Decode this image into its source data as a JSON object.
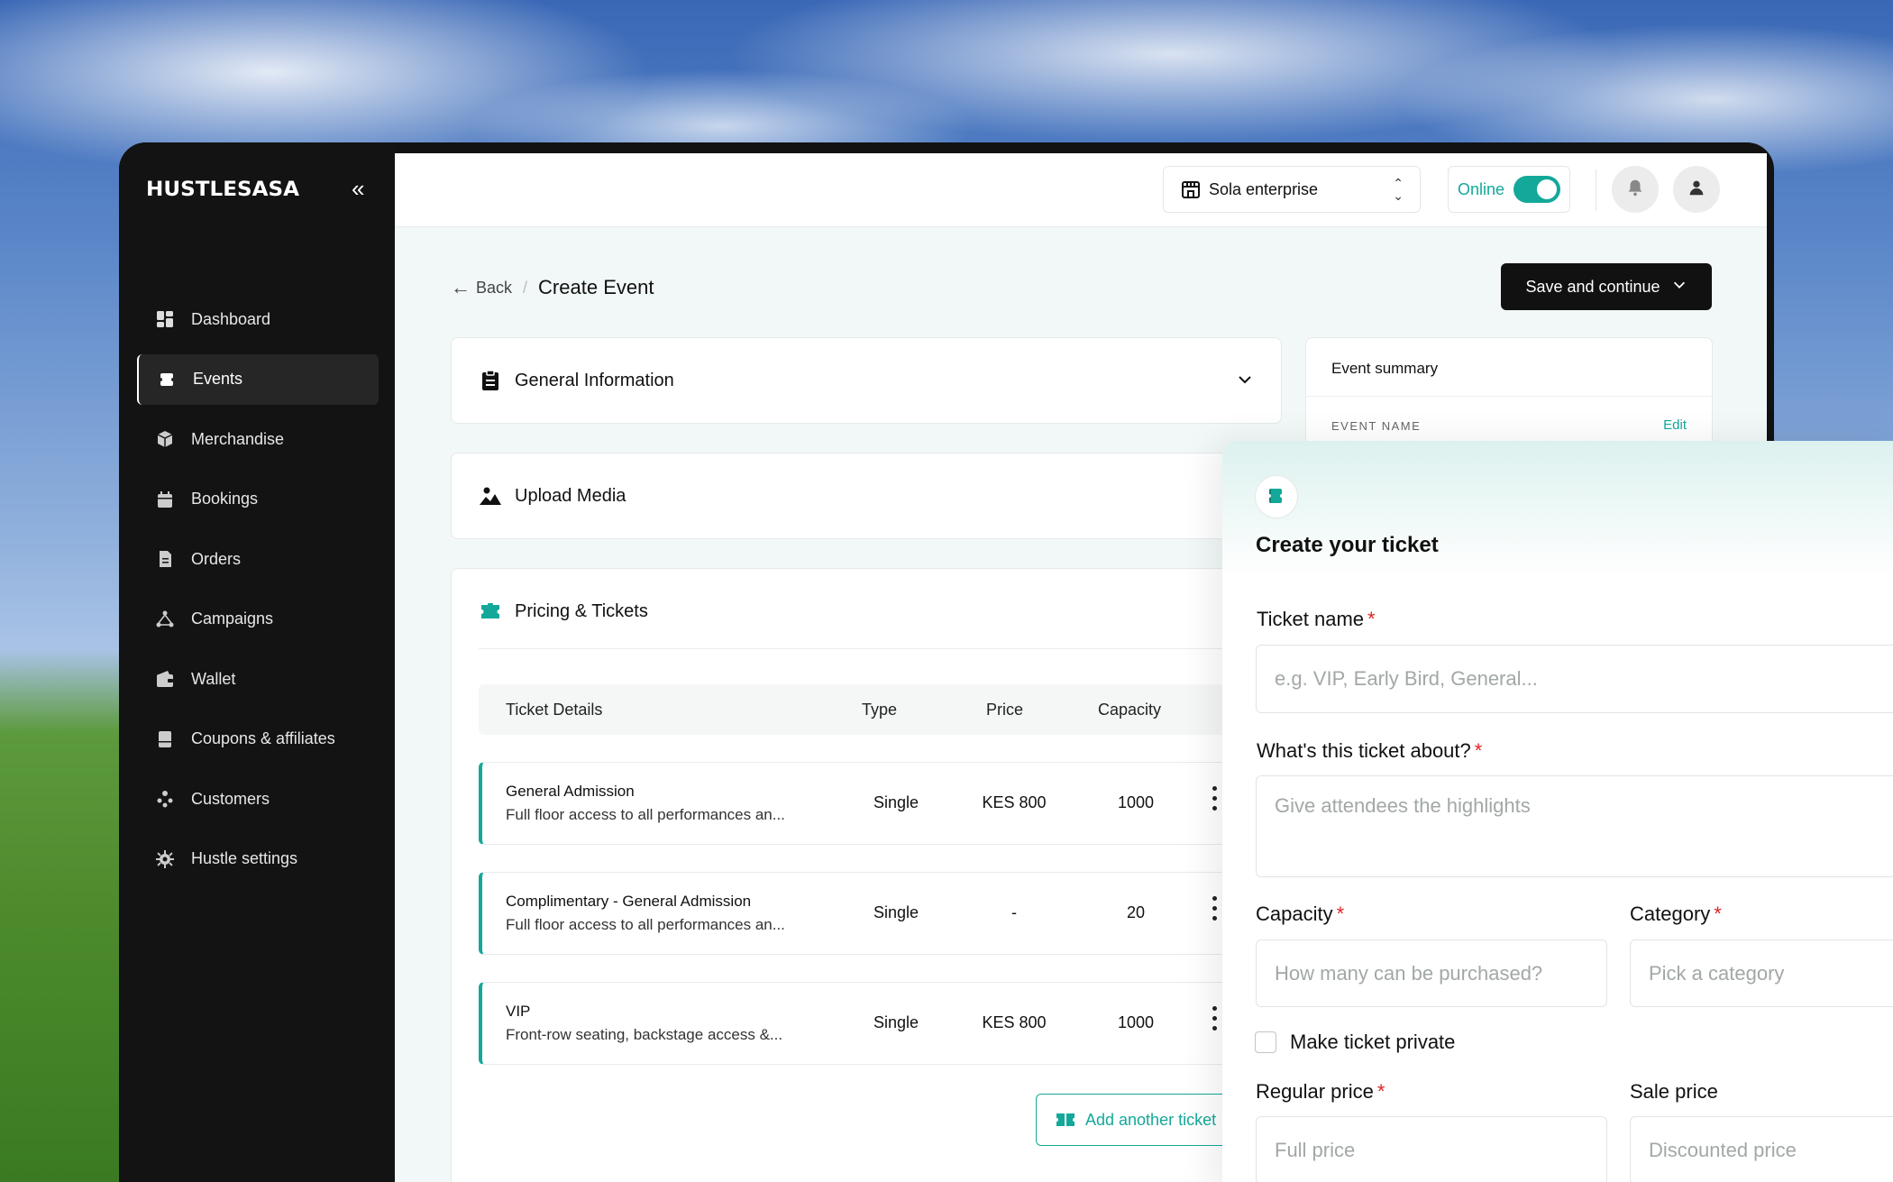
{
  "sidebar": {
    "logo": "HUSTLESASA",
    "collapse_glyph": "«",
    "items": [
      {
        "label": "Dashboard",
        "icon": "dashboard-icon",
        "active": false
      },
      {
        "label": "Events",
        "icon": "events-icon",
        "active": true
      },
      {
        "label": "Merchandise",
        "icon": "box-icon",
        "active": false
      },
      {
        "label": "Bookings",
        "icon": "calendar-icon",
        "active": false
      },
      {
        "label": "Orders",
        "icon": "document-icon",
        "active": false
      },
      {
        "label": "Campaigns",
        "icon": "campaigns-icon",
        "active": false
      },
      {
        "label": "Wallet",
        "icon": "wallet-icon",
        "active": false
      },
      {
        "label": "Coupons & affiliates",
        "icon": "coupon-icon",
        "active": false
      },
      {
        "label": "Customers",
        "icon": "customers-icon",
        "active": false
      },
      {
        "label": "Hustle settings",
        "icon": "gear-icon",
        "active": false
      }
    ]
  },
  "topbar": {
    "org_name": "Sola enterprise",
    "online_label": "Online",
    "online_enabled": true
  },
  "header": {
    "back_label": "Back",
    "separator": "/",
    "title": "Create Event",
    "save_label": "Save and continue"
  },
  "sections": {
    "general": "General Information",
    "media": "Upload Media",
    "pricing": "Pricing & Tickets"
  },
  "table": {
    "headers": {
      "details": "Ticket Details",
      "type": "Type",
      "price": "Price",
      "capacity": "Capacity"
    },
    "rows": [
      {
        "name": "General Admission",
        "desc": "Full floor access to all performances an...",
        "type": "Single",
        "price": "KES 800",
        "capacity": "1000"
      },
      {
        "name": "Complimentary - General Admission",
        "desc": "Full floor access to all performances an...",
        "type": "Single",
        "price": "-",
        "capacity": "20"
      },
      {
        "name": "VIP",
        "desc": "Front-row seating, backstage access &...",
        "type": "Single",
        "price": "KES 800",
        "capacity": "1000"
      }
    ],
    "add_label": "Add another ticket"
  },
  "summary": {
    "title": "Event summary",
    "event_name_label": "EVENT NAME",
    "edit_label": "Edit"
  },
  "modal": {
    "title": "Create your ticket",
    "ticket_name_label": "Ticket name",
    "ticket_name_placeholder": "e.g. VIP, Early Bird, General...",
    "about_label": "What's this ticket about?",
    "about_placeholder": "Give attendees the highlights",
    "capacity_label": "Capacity",
    "capacity_placeholder": "How many can be purchased?",
    "category_label": "Category",
    "category_placeholder": "Pick a category",
    "private_label": "Make ticket private",
    "private_checked": false,
    "regular_price_label": "Regular price",
    "regular_price_placeholder": "Full price",
    "sale_price_label": "Sale price",
    "sale_price_placeholder": "Discounted price",
    "required_mark": "*"
  },
  "colors": {
    "accent": "#14a89a",
    "sidebar_bg": "#131313",
    "main_bg": "#f2f8f7",
    "required": "#e02424"
  }
}
